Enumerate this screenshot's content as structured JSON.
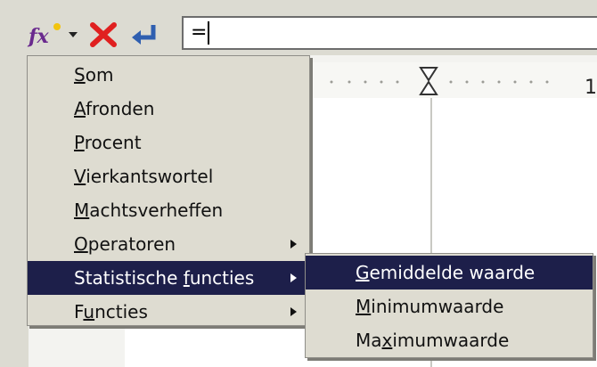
{
  "formula_bar": {
    "input_value": "="
  },
  "ruler": {
    "number": "1"
  },
  "main_menu": {
    "items": [
      {
        "u": "S",
        "rest": "om"
      },
      {
        "u": "A",
        "rest": "fronden"
      },
      {
        "u": "P",
        "rest": "rocent"
      },
      {
        "u": "V",
        "rest": "ierkantswortel"
      },
      {
        "u": "M",
        "rest": "achtsverheffen"
      },
      {
        "u": "O",
        "rest": "peratoren",
        "has_submenu": true
      },
      {
        "pre": "Statistische ",
        "u": "f",
        "rest": "uncties",
        "has_submenu": true,
        "highlighted": true
      },
      {
        "pre": "F",
        "u": "u",
        "rest": "ncties",
        "has_submenu": true
      }
    ]
  },
  "sub_menu": {
    "items": [
      {
        "u": "G",
        "rest": "emiddelde waarde",
        "highlighted": true
      },
      {
        "u": "M",
        "rest": "inimumwaarde"
      },
      {
        "pre": "Ma",
        "u": "x",
        "rest": "imumwaarde"
      }
    ]
  },
  "colors": {
    "highlight": "#1d1f4a",
    "menu_bg": "#dedcd1",
    "cancel": "#e02020",
    "accept": "#2f5fb0"
  }
}
